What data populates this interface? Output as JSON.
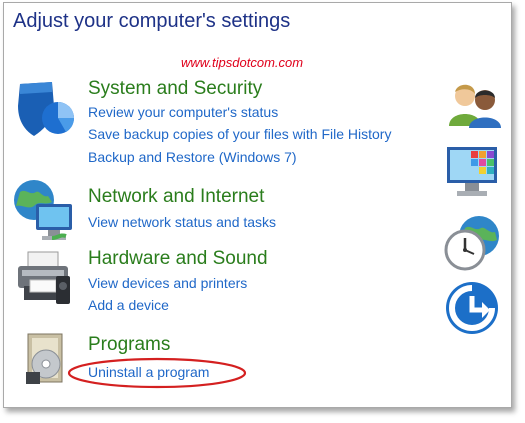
{
  "page": {
    "title": "Adjust your computer's settings",
    "watermark": "www.tipsdotcom.com"
  },
  "categories": [
    {
      "title": "System and Security",
      "links": [
        "Review your computer's status",
        "Save backup copies of your files with File History",
        "Backup and Restore (Windows 7)"
      ]
    },
    {
      "title": "Network and Internet",
      "links": [
        "View network status and tasks"
      ]
    },
    {
      "title": "Hardware and Sound",
      "links": [
        "View devices and printers",
        "Add a device"
      ]
    },
    {
      "title": "Programs",
      "links": [
        "Uninstall a program"
      ]
    }
  ],
  "right_icons": [
    "user-accounts-icon",
    "appearance-icon",
    "clock-region-icon",
    "ease-of-access-icon"
  ],
  "highlight_color": "#d42020"
}
